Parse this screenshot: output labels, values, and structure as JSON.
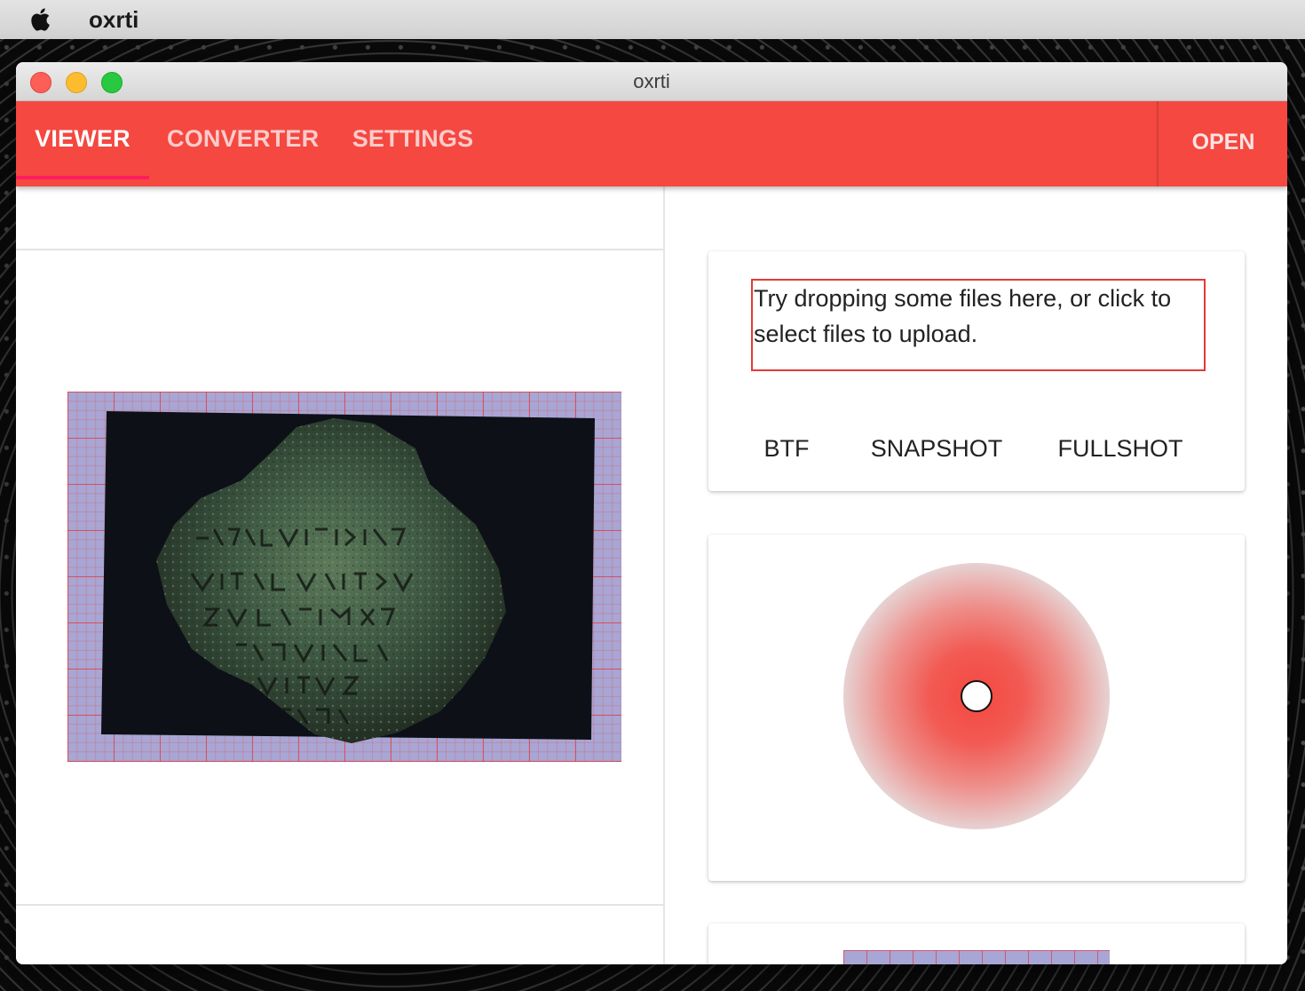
{
  "menubar": {
    "app_name": "oxrti"
  },
  "window": {
    "title": "oxrti"
  },
  "tabs": [
    {
      "label": "VIEWER",
      "active": true
    },
    {
      "label": "CONVERTER",
      "active": false
    },
    {
      "label": "SETTINGS",
      "active": false
    }
  ],
  "toolbar": {
    "open_label": "OPEN"
  },
  "upload": {
    "dropzone_text": "Try dropping some files here, or click to select files to upload.",
    "buttons": [
      "BTF",
      "SNAPSHOT",
      "FULLSHOT"
    ]
  },
  "colors": {
    "accent": "#f44841",
    "tab_indicator": "#ff1d5e",
    "dropzone_border": "#e53935"
  },
  "icons": {
    "apple": "apple-icon",
    "light_handle": "light-direction-handle"
  }
}
